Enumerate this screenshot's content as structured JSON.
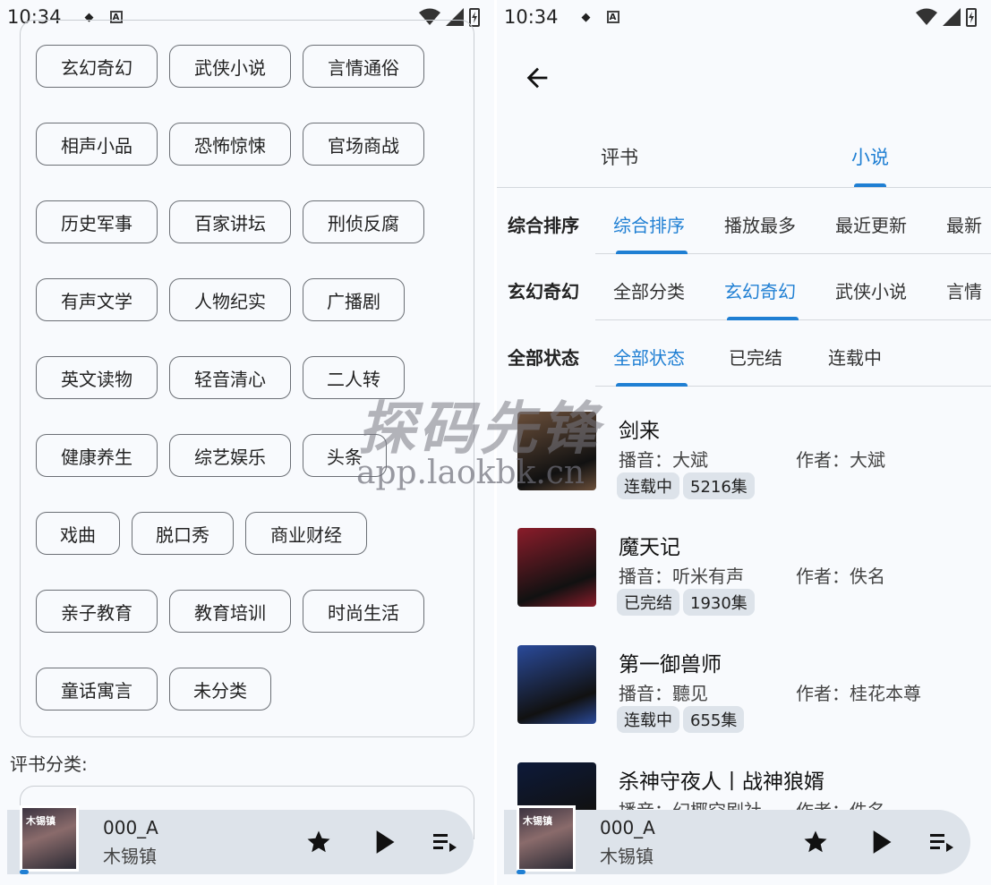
{
  "status": {
    "time": "10:34"
  },
  "left": {
    "categories": [
      [
        "玄幻奇幻",
        "武侠小说",
        "言情通俗"
      ],
      [
        "相声小品",
        "恐怖惊悚",
        "官场商战"
      ],
      [
        "历史军事",
        "百家讲坛",
        "刑侦反腐"
      ],
      [
        "有声文学",
        "人物纪实",
        "广播剧"
      ],
      [
        "英文读物",
        "轻音清心",
        "二人转"
      ],
      [
        "健康养生",
        "综艺娱乐",
        "头条"
      ],
      [
        "戏曲",
        "脱口秀",
        "商业财经"
      ],
      [
        "亲子教育",
        "教育培训",
        "时尚生活"
      ],
      [
        "童话寓言",
        "未分类"
      ]
    ],
    "section_label": "评书分类:"
  },
  "player": {
    "title": "000_A",
    "subtitle": "木锡镇",
    "cover_text": "木锡镇"
  },
  "right": {
    "tabs": [
      "评书",
      "小说"
    ],
    "sort": {
      "label": "综合排序",
      "options": [
        "综合排序",
        "播放最多",
        "最近更新",
        "最新"
      ]
    },
    "category": {
      "label": "玄幻奇幻",
      "options": [
        "全部分类",
        "玄幻奇幻",
        "武侠小说",
        "言情"
      ]
    },
    "state": {
      "label": "全部状态",
      "options": [
        "全部状态",
        "已完结",
        "连载中"
      ]
    },
    "books": [
      {
        "title": "剑来",
        "narrator": "播音：大斌",
        "author": "作者：大斌",
        "status": "连载中",
        "episodes": "5216集",
        "color": "#6b4f3a"
      },
      {
        "title": "魔天记",
        "narrator": "播音：听米有声",
        "author": "作者：佚名",
        "status": "已完结",
        "episodes": "1930集",
        "color": "#8a1c2a"
      },
      {
        "title": "第一御兽师",
        "narrator": "播音：聽见",
        "author": "作者：桂花本尊",
        "status": "连载中",
        "episodes": "655集",
        "color": "#2a4a9a"
      },
      {
        "title": "杀神守夜人丨战神狼婿",
        "narrator": "播音：幻椰空剧社",
        "author": "作者：佚名",
        "status": "",
        "episodes": "",
        "color": "#0d1a3a"
      }
    ]
  },
  "watermark": {
    "text": "探码先锋",
    "url": "app.laokbk.cn"
  }
}
